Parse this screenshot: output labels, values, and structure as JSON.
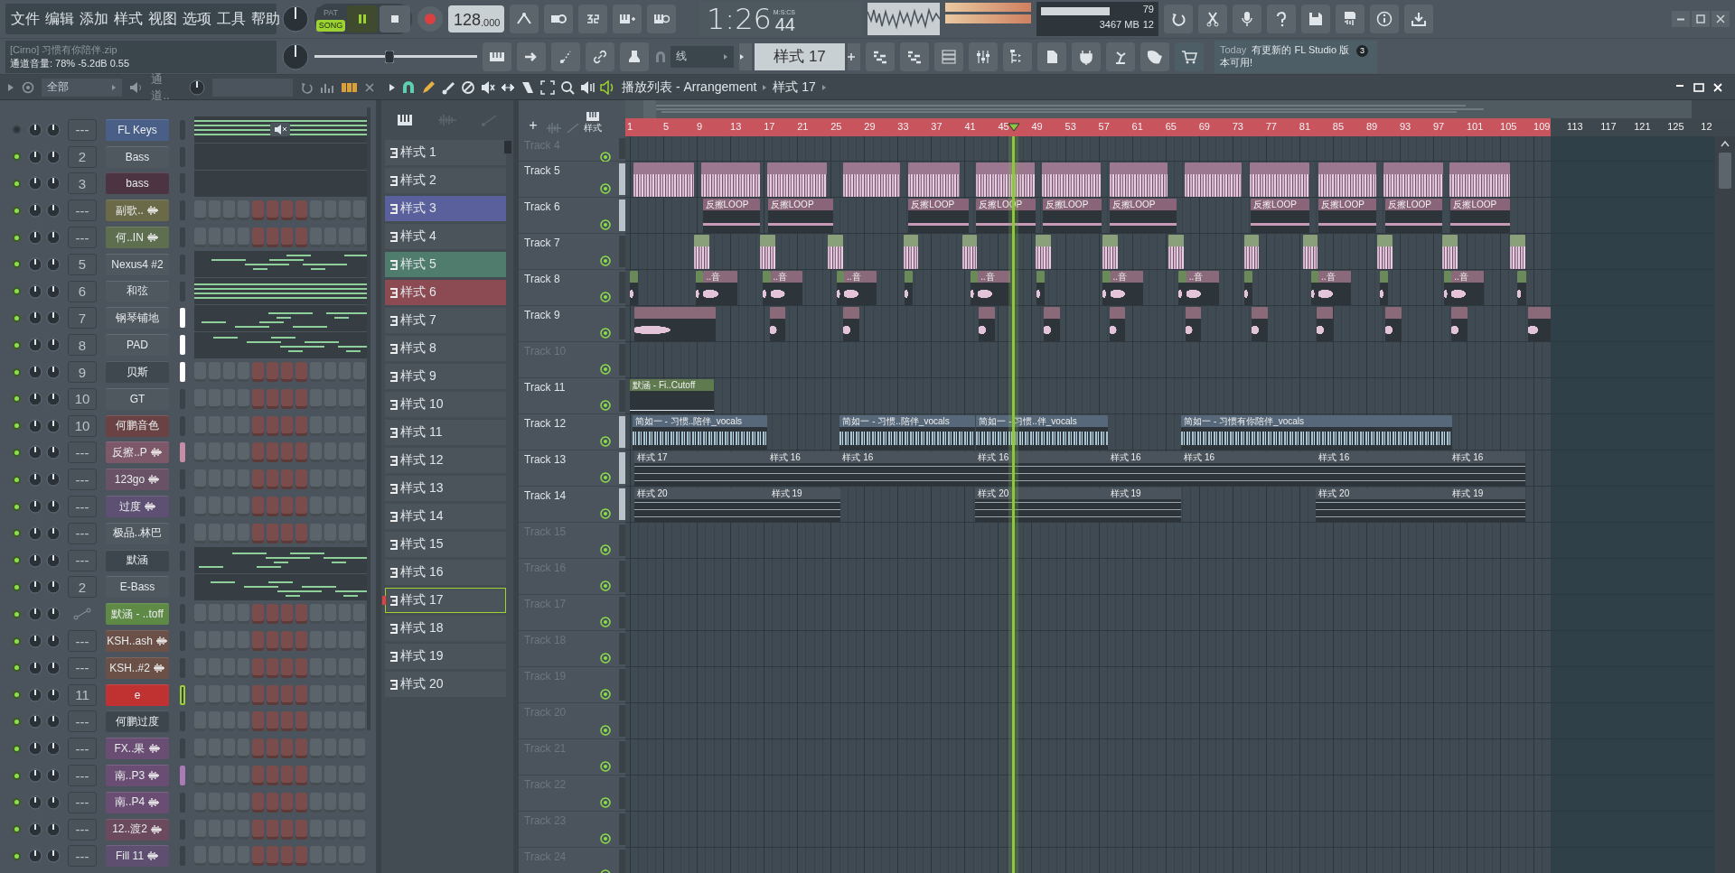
{
  "menu": [
    "文件",
    "编辑",
    "添加",
    "样式",
    "视图",
    "选项",
    "工具",
    "帮助"
  ],
  "transport": {
    "modes": [
      {
        "label": "PAT",
        "selected": false
      },
      {
        "label": "SONG",
        "selected": true
      }
    ],
    "playing": true,
    "recording": false,
    "tempo": "128",
    "tempo_decimals": ".000"
  },
  "hint": {
    "title": "[Cirno] 习惯有你陪伴.zip",
    "text": "通道音量: 78%   -5.2dB   0.55"
  },
  "master_pitch": {
    "level": 0.46
  },
  "clock": {
    "time": "1:26",
    "centiseconds": "44",
    "unit": "M:S:CS"
  },
  "cpu": {
    "polyphony": "79",
    "memory": "3467 MB",
    "voices": "12"
  },
  "snap": "线",
  "pattern": "样式 17",
  "news": {
    "label": "Today",
    "text": "有更新的 FL Studio 版本可用!",
    "badge": "3"
  },
  "channel_rack": {
    "filter": "全部",
    "group": "通道..",
    "channels": [
      {
        "name": "FL Keys",
        "mixer": "---",
        "color": "#4a5f88",
        "on": false,
        "sample": false,
        "selected": false,
        "focused": false,
        "kind": "roll"
      },
      {
        "name": "Bass",
        "mixer": "2",
        "color": "#4f575f",
        "on": true,
        "sample": false,
        "selected": false,
        "focused": false,
        "kind": "blank"
      },
      {
        "name": "bass",
        "mixer": "3",
        "color": "#4c3442",
        "on": true,
        "sample": false,
        "selected": false,
        "focused": false,
        "kind": "blank"
      },
      {
        "name": "副歌..",
        "mixer": "---",
        "color": "#6b6a48",
        "on": true,
        "sample": true,
        "selected": false,
        "focused": false,
        "kind": "steps"
      },
      {
        "name": "何..IN",
        "mixer": "---",
        "color": "#5d6f4e",
        "on": true,
        "sample": true,
        "selected": false,
        "focused": false,
        "kind": "steps"
      },
      {
        "name": "Nexus4 #2",
        "mixer": "5",
        "color": "#4f575f",
        "on": true,
        "sample": false,
        "selected": false,
        "focused": false,
        "kind": "roll"
      },
      {
        "name": "和弦",
        "mixer": "6",
        "color": "#4f575f",
        "on": true,
        "sample": false,
        "selected": false,
        "focused": false,
        "kind": "roll"
      },
      {
        "name": "钢琴铺地",
        "mixer": "7",
        "color": "#4f575f",
        "on": true,
        "sample": false,
        "selected": true,
        "focused": false,
        "kind": "roll"
      },
      {
        "name": "PAD",
        "mixer": "8",
        "color": "#4f575f",
        "on": true,
        "sample": false,
        "selected": true,
        "focused": false,
        "kind": "roll"
      },
      {
        "name": "贝斯",
        "mixer": "9",
        "color": "#40484f",
        "on": true,
        "sample": false,
        "selected": true,
        "focused": false,
        "kind": "steps"
      },
      {
        "name": "GT",
        "mixer": "10",
        "color": "#4f575f",
        "on": true,
        "sample": false,
        "selected": false,
        "focused": false,
        "kind": "steps"
      },
      {
        "name": "何鹏音色",
        "mixer": "10",
        "color": "#6a4244",
        "on": true,
        "sample": false,
        "selected": false,
        "focused": false,
        "kind": "steps"
      },
      {
        "name": "反擦..P",
        "mixer": "---",
        "color": "#7c5868",
        "on": true,
        "sample": true,
        "selected": true,
        "focused": false,
        "kind": "steps"
      },
      {
        "name": "123go",
        "mixer": "---",
        "color": "#6a5266",
        "on": true,
        "sample": true,
        "selected": false,
        "focused": false,
        "kind": "steps"
      },
      {
        "name": "过度",
        "mixer": "---",
        "color": "#5e5072",
        "on": true,
        "sample": true,
        "selected": false,
        "focused": false,
        "kind": "steps"
      },
      {
        "name": "极品..林巴",
        "mixer": "---",
        "color": "#4f575f",
        "on": true,
        "sample": false,
        "selected": false,
        "focused": false,
        "kind": "steps"
      },
      {
        "name": "默涵",
        "mixer": "---",
        "color": "#3e464d",
        "on": true,
        "sample": false,
        "selected": false,
        "focused": false,
        "kind": "roll"
      },
      {
        "name": "E-Bass",
        "mixer": "2",
        "color": "#4f575f",
        "on": true,
        "sample": false,
        "selected": false,
        "focused": false,
        "kind": "roll"
      },
      {
        "name": "默涵 - ..toff",
        "color": "#5e8a46",
        "on": true,
        "sample": false,
        "selected": false,
        "focused": false,
        "kind": "steps"
      },
      {
        "name": "KSH..ash",
        "mixer": "---",
        "color": "#6b5048",
        "on": true,
        "sample": true,
        "selected": false,
        "focused": false,
        "kind": "steps"
      },
      {
        "name": "KSH..#2",
        "mixer": "---",
        "color": "#6b5048",
        "on": true,
        "sample": true,
        "selected": false,
        "focused": false,
        "kind": "steps"
      },
      {
        "name": "e",
        "mixer": "11",
        "color": "#c03232",
        "on": true,
        "sample": false,
        "selected": false,
        "focused": true,
        "kind": "steps"
      },
      {
        "name": "何鹏过度",
        "mixer": "---",
        "color": "#3e464d",
        "on": true,
        "sample": false,
        "selected": false,
        "focused": false,
        "kind": "steps"
      },
      {
        "name": "FX..果",
        "mixer": "---",
        "color": "#6a4d72",
        "on": true,
        "sample": true,
        "selected": false,
        "focused": false,
        "kind": "steps"
      },
      {
        "name": "南..P3",
        "mixer": "---",
        "color": "#6a4d72",
        "on": true,
        "sample": true,
        "selected": true,
        "focused": false,
        "kind": "steps"
      },
      {
        "name": "南..P4",
        "mixer": "---",
        "color": "#6a4d72",
        "on": true,
        "sample": true,
        "selected": false,
        "focused": false,
        "kind": "steps"
      },
      {
        "name": "12..渡2",
        "mixer": "---",
        "color": "#6c4a5e",
        "on": true,
        "sample": true,
        "selected": false,
        "focused": false,
        "kind": "steps"
      },
      {
        "name": "Fill 11",
        "mixer": "---",
        "color": "#5e4e70",
        "on": true,
        "sample": true,
        "selected": false,
        "focused": false,
        "kind": "steps"
      }
    ]
  },
  "patterns": [
    {
      "label": "样式 1",
      "color": "#4b535b",
      "selected": false
    },
    {
      "label": "样式 2",
      "color": "#4b535b",
      "selected": false
    },
    {
      "label": "样式 3",
      "color": "#5a609c",
      "selected": false
    },
    {
      "label": "样式 4",
      "color": "#4b535b",
      "selected": false
    },
    {
      "label": "样式 5",
      "color": "#4f7c6c",
      "selected": false
    },
    {
      "label": "样式 6",
      "color": "#8c4a52",
      "selected": false
    },
    {
      "label": "样式 7",
      "color": "#4b535b",
      "selected": false
    },
    {
      "label": "样式 8",
      "color": "#4b535b",
      "selected": false
    },
    {
      "label": "样式 9",
      "color": "#4b535b",
      "selected": false
    },
    {
      "label": "样式 10",
      "color": "#4b535b",
      "selected": false
    },
    {
      "label": "样式 11",
      "color": "#4b535b",
      "selected": false
    },
    {
      "label": "样式 12",
      "color": "#4b535b",
      "selected": false
    },
    {
      "label": "样式 13",
      "color": "#4b535b",
      "selected": false
    },
    {
      "label": "样式 14",
      "color": "#4b535b",
      "selected": false
    },
    {
      "label": "样式 15",
      "color": "#4b535b",
      "selected": false
    },
    {
      "label": "样式 16",
      "color": "#4b535b",
      "selected": false
    },
    {
      "label": "样式 17",
      "color": "#4b535b",
      "selected": true
    },
    {
      "label": "样式 18",
      "color": "#4b535b",
      "selected": false
    },
    {
      "label": "样式 19",
      "color": "#4b535b",
      "selected": false
    },
    {
      "label": "样式 20",
      "color": "#4b535b",
      "selected": false
    }
  ],
  "playlist": {
    "title": "播放列表 - Arrangement",
    "pattern": "样式 17",
    "add_label": "+",
    "tab_label": "样式",
    "playhead": {
      "level": 0.356
    },
    "ruler": [
      "1",
      "5",
      "9",
      "13",
      "17",
      "21",
      "25",
      "29",
      "33",
      "37",
      "41",
      "45",
      "49",
      "53",
      "57",
      "61",
      "65",
      "69",
      "73",
      "77",
      "81",
      "85",
      "89",
      "93",
      "97",
      "101",
      "105",
      "109",
      "113",
      "117",
      "121",
      "125",
      "12"
    ],
    "tracks": [
      {
        "name": "Track 4",
        "empty": true,
        "selected": false
      },
      {
        "name": "Track 5",
        "empty": false,
        "selected": true,
        "clips": [
          {
            "kind": "wave",
            "color": "#9c7890"
          },
          {
            "kind": "wave",
            "color": "#9c7890"
          },
          {
            "kind": "wave",
            "color": "#9c7890"
          },
          {
            "kind": "wave",
            "color": "#9c7890"
          },
          {
            "kind": "wave",
            "color": "#9c7890"
          },
          {
            "kind": "wave",
            "color": "#9c7890"
          },
          {
            "kind": "wave",
            "color": "#9c7890"
          },
          {
            "kind": "wave",
            "color": "#9c7890"
          },
          {
            "kind": "wave",
            "color": "#9c7890"
          },
          {
            "kind": "wave",
            "color": "#9c7890"
          },
          {
            "kind": "wave",
            "color": "#9c7890"
          },
          {
            "kind": "wave",
            "color": "#9c7890"
          },
          {
            "kind": "wave",
            "color": "#9c7890"
          }
        ]
      },
      {
        "name": "Track 6",
        "empty": false,
        "selected": true,
        "clips": [
          {
            "kind": "line",
            "color": "#8a6478",
            "label": "反擦LOOP"
          },
          {
            "kind": "line",
            "color": "#8a6478",
            "label": "反擦LOOP"
          },
          {
            "kind": "line",
            "color": "#8a6478",
            "label": "反擦LOOP"
          },
          {
            "kind": "line",
            "color": "#8a6478",
            "label": "反擦LOOP"
          },
          {
            "kind": "line",
            "color": "#8a6478",
            "label": "反擦LOOP"
          },
          {
            "kind": "line",
            "color": "#8a6478",
            "label": "反擦LOOP"
          },
          {
            "kind": "line",
            "color": "#8a6478",
            "label": "反擦LOOP"
          },
          {
            "kind": "line",
            "color": "#8a6478",
            "label": "反擦LOOP"
          },
          {
            "kind": "line",
            "color": "#8a6478",
            "label": "反擦LOOP"
          },
          {
            "kind": "line",
            "color": "#8a6478",
            "label": "反擦LOOP"
          }
        ]
      },
      {
        "name": "Track 7",
        "empty": false,
        "selected": false,
        "clips": [
          {
            "kind": "wave",
            "color": "#8aa07a"
          },
          {
            "kind": "wave",
            "color": "#8aa07a"
          },
          {
            "kind": "wave",
            "color": "#8aa07a"
          },
          {
            "kind": "wave",
            "color": "#8aa07a"
          },
          {
            "kind": "wave",
            "color": "#8aa07a"
          },
          {
            "kind": "wave",
            "color": "#8aa07a"
          },
          {
            "kind": "wave",
            "color": "#8aa07a"
          },
          {
            "kind": "wave",
            "color": "#8aa07a"
          },
          {
            "kind": "wave",
            "color": "#8aa07a"
          },
          {
            "kind": "wave",
            "color": "#8aa07a"
          },
          {
            "kind": "wave",
            "color": "#8aa07a"
          },
          {
            "kind": "wave",
            "color": "#8aa07a"
          },
          {
            "kind": "wave",
            "color": "#8aa07a"
          }
        ]
      },
      {
        "name": "Track 8",
        "empty": false,
        "selected": false,
        "clips": [
          {
            "kind": "spike",
            "color": "#6a8a5a"
          },
          {
            "kind": "spike",
            "color": "#6a8a5a"
          },
          {
            "kind": "spike",
            "color": "#8a6a7a",
            "label": "..音"
          },
          {
            "kind": "spike",
            "color": "#6a8a5a"
          },
          {
            "kind": "spike",
            "color": "#8a6a7a",
            "label": "..音"
          },
          {
            "kind": "spike",
            "color": "#6a8a5a"
          },
          {
            "kind": "spike",
            "color": "#8a6a7a",
            "label": "..音"
          },
          {
            "kind": "spike",
            "color": "#6a8a5a"
          },
          {
            "kind": "spike",
            "color": "#6a8a5a"
          },
          {
            "kind": "spike",
            "color": "#8a6a7a",
            "label": "..音"
          },
          {
            "kind": "spike",
            "color": "#6a8a5a"
          },
          {
            "kind": "spike",
            "color": "#6a8a5a"
          },
          {
            "kind": "spike",
            "color": "#8a6a7a",
            "label": "..音"
          },
          {
            "kind": "spike",
            "color": "#6a8a5a"
          },
          {
            "kind": "spike",
            "color": "#8a6a7a",
            "label": "..音"
          },
          {
            "kind": "spike",
            "color": "#6a8a5a"
          },
          {
            "kind": "spike",
            "color": "#6a8a5a"
          },
          {
            "kind": "spike",
            "color": "#8a6a7a",
            "label": "..音"
          },
          {
            "kind": "spike",
            "color": "#6a8a5a"
          },
          {
            "kind": "spike",
            "color": "#6a8a5a"
          },
          {
            "kind": "spike",
            "color": "#8a6a7a",
            "label": "..音"
          },
          {
            "kind": "spike",
            "color": "#6a8a5a"
          }
        ]
      },
      {
        "name": "Track 9",
        "empty": false,
        "selected": false,
        "clips": [
          {
            "kind": "spike",
            "color": "#8a6a78"
          },
          {
            "kind": "spike",
            "color": "#8a6a78"
          },
          {
            "kind": "spike",
            "color": "#8a6a78"
          },
          {
            "kind": "spike",
            "color": "#8a6a78"
          },
          {
            "kind": "spike",
            "color": "#8a6a78"
          },
          {
            "kind": "spike",
            "color": "#8a6a78"
          },
          {
            "kind": "spike",
            "color": "#8a6a78"
          },
          {
            "kind": "spike",
            "color": "#8a6a78"
          },
          {
            "kind": "spike",
            "color": "#8a6a78"
          },
          {
            "kind": "spike",
            "color": "#8a6a78"
          },
          {
            "kind": "spike",
            "color": "#8a6a78"
          },
          {
            "kind": "spike",
            "color": "#8a6a78"
          }
        ]
      },
      {
        "name": "Track 10",
        "empty": true,
        "selected": false
      },
      {
        "name": "Track 11",
        "empty": false,
        "selected": false,
        "clips": [
          {
            "kind": "automation",
            "color": "#5e7a4e",
            "label": "默涵 - Fi..Cutoff"
          }
        ]
      },
      {
        "name": "Track 12",
        "empty": false,
        "selected": true,
        "clips": [
          {
            "kind": "vocal",
            "color": "#56687a",
            "label": "简如一 - 习惯..陪伴_vocals"
          },
          {
            "kind": "vocal",
            "color": "#56687a",
            "label": "简如一 - 习惯..陪伴_vocals"
          },
          {
            "kind": "vocal",
            "color": "#56687a",
            "label": "简如一 - 习惯..伴_vocals"
          },
          {
            "kind": "vocal",
            "color": "#56687a",
            "label": "简如一 - 习惯有你陪伴_vocals"
          }
        ]
      },
      {
        "name": "Track 13",
        "empty": false,
        "selected": true,
        "clips": [
          {
            "kind": "pattern",
            "color": "#4a535c",
            "label": "样式 17"
          },
          {
            "kind": "pattern",
            "color": "#4a535c",
            "label": "样式 16"
          },
          {
            "kind": "pattern",
            "color": "#4a535c",
            "label": "样式 16"
          },
          {
            "kind": "pattern",
            "color": "#4a535c",
            "label": "样式 16"
          },
          {
            "kind": "pattern",
            "color": "#4a535c",
            "label": "样式 16"
          },
          {
            "kind": "pattern",
            "color": "#4a535c",
            "label": "样式 16"
          },
          {
            "kind": "pattern",
            "color": "#4a535c",
            "label": "样式 16"
          },
          {
            "kind": "pattern",
            "color": "#4a535c",
            "label": "样式 16"
          }
        ]
      },
      {
        "name": "Track 14",
        "empty": false,
        "selected": true,
        "clips": [
          {
            "kind": "pattern",
            "color": "#4a535c",
            "label": "样式 20"
          },
          {
            "kind": "pattern",
            "color": "#4a535c",
            "label": "样式 19"
          },
          {
            "kind": "pattern",
            "color": "#4a535c",
            "label": "样式 20"
          },
          {
            "kind": "pattern",
            "color": "#4a535c",
            "label": "样式 19"
          },
          {
            "kind": "pattern",
            "color": "#4a535c",
            "label": "样式 20"
          },
          {
            "kind": "pattern",
            "color": "#4a535c",
            "label": "样式 19"
          }
        ]
      },
      {
        "name": "Track 15",
        "empty": true,
        "selected": false
      },
      {
        "name": "Track 16",
        "empty": true,
        "selected": false
      },
      {
        "name": "Track 17",
        "empty": true,
        "selected": false
      },
      {
        "name": "Track 18",
        "empty": true,
        "selected": false
      },
      {
        "name": "Track 19",
        "empty": true,
        "selected": false
      },
      {
        "name": "Track 20",
        "empty": true,
        "selected": false
      },
      {
        "name": "Track 21",
        "empty": true,
        "selected": false
      },
      {
        "name": "Track 22",
        "empty": true,
        "selected": false
      },
      {
        "name": "Track 23",
        "empty": true,
        "selected": false
      },
      {
        "name": "Track 24",
        "empty": true,
        "selected": false
      }
    ]
  }
}
